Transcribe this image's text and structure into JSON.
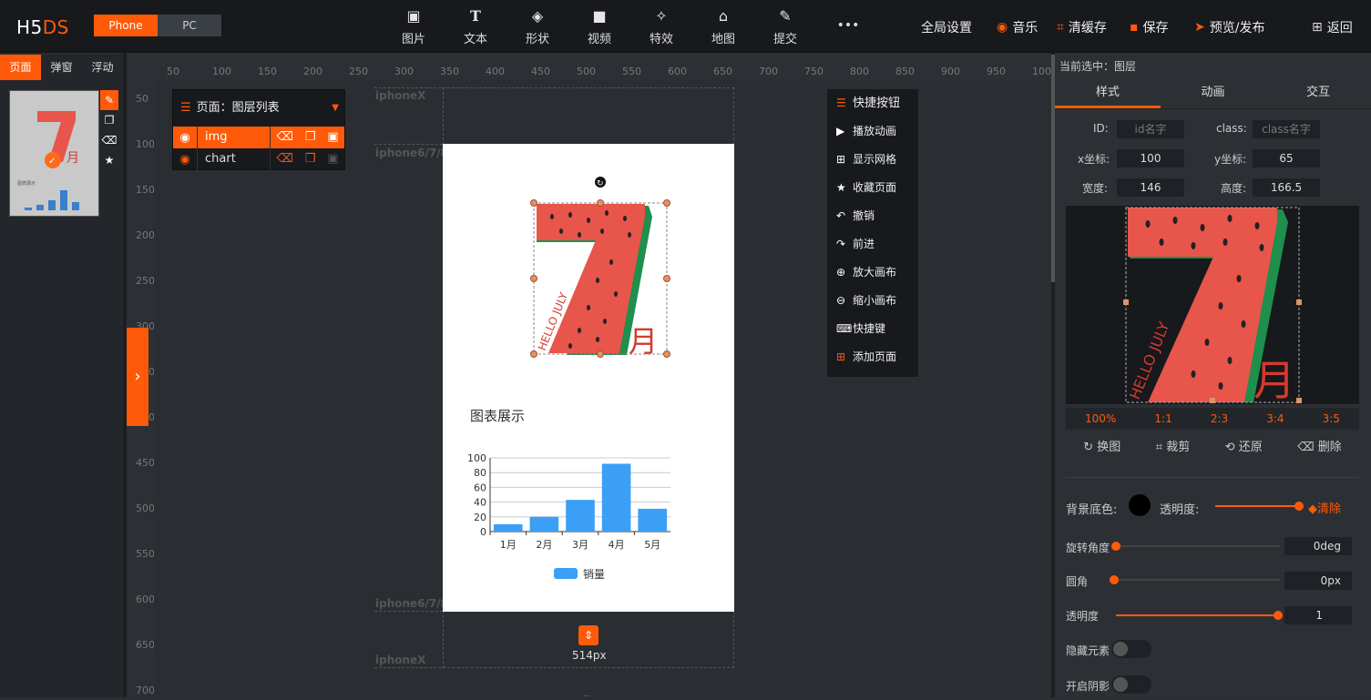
{
  "app": {
    "logo_a": "H5",
    "logo_b": "DS",
    "device_phone": "Phone",
    "device_pc": "PC"
  },
  "toolbar": [
    {
      "label": "图片",
      "icon": "image-icon"
    },
    {
      "label": "文本",
      "icon": "text-icon"
    },
    {
      "label": "形状",
      "icon": "shape-icon"
    },
    {
      "label": "视频",
      "icon": "video-icon"
    },
    {
      "label": "特效",
      "icon": "effect-icon"
    },
    {
      "label": "地图",
      "icon": "map-icon"
    },
    {
      "label": "提交",
      "icon": "submit-icon"
    },
    {
      "label": "•••",
      "icon": "more-icon"
    }
  ],
  "topright": {
    "global": "全局设置",
    "music": "音乐",
    "clear": "清缓存",
    "save": "保存",
    "publish": "预览/发布",
    "back": "返回"
  },
  "lefttabs": [
    "页面",
    "弹窗",
    "浮动"
  ],
  "thumb": {
    "chart_title": "图表展示"
  },
  "ruler_h": [
    "50",
    "100",
    "150",
    "200",
    "250",
    "300",
    "350",
    "400",
    "450",
    "500",
    "550",
    "600",
    "650",
    "700",
    "750",
    "800",
    "850",
    "900",
    "950",
    "100"
  ],
  "ruler_v": [
    "50",
    "100",
    "150",
    "200",
    "250",
    "300",
    "350",
    "400",
    "450",
    "500",
    "550",
    "600",
    "650",
    "700"
  ],
  "guides": {
    "iphonex_top": "iphoneX",
    "iphone678_top": "iphone6/7/8",
    "iphone678_bot": "iphone6/7/8",
    "iphonex_bot": "iphoneX"
  },
  "layerpanel": {
    "title": "页面：图层列表",
    "layers": [
      "img",
      "chart"
    ]
  },
  "quick": [
    "快捷按钮",
    "播放动画",
    "显示网格",
    "收藏页面",
    "撤销",
    "前进",
    "放大画布",
    "缩小画布",
    "快捷键",
    "添加页面"
  ],
  "phone": {
    "hello": "HELLO JULY",
    "month": "月",
    "height_label": "514px"
  },
  "chart_data": {
    "type": "bar",
    "title": "图表展示",
    "categories": [
      "1月",
      "2月",
      "3月",
      "4月",
      "5月"
    ],
    "series": [
      {
        "name": "销量",
        "values": [
          10,
          20,
          43,
          92,
          31
        ]
      }
    ],
    "ylim": [
      0,
      100
    ],
    "yticks": [
      0,
      20,
      40,
      60,
      80,
      100
    ],
    "color": "#3a9ff5",
    "grid": true,
    "legend": "bottom"
  },
  "right": {
    "current": "当前选中：图层",
    "tabs": [
      "样式",
      "动画",
      "交互"
    ],
    "id_label": "ID:",
    "id_ph": "id名字",
    "class_label": "class:",
    "class_ph": "class名字",
    "x_label": "x坐标:",
    "x_val": "100",
    "y_label": "y坐标:",
    "y_val": "65",
    "w_label": "宽度:",
    "w_val": "146",
    "h_label": "高度:",
    "h_val": "166.5",
    "ratios": [
      "100%",
      "1:1",
      "2:3",
      "3:4",
      "3:5"
    ],
    "imgops": [
      "换图",
      "裁剪",
      "还原",
      "删除"
    ],
    "bg_label": "背景底色:",
    "opacity_label": "透明度:",
    "clear": "清除",
    "rotate_label": "旋转角度",
    "rotate_val": "0deg",
    "radius_label": "圆角",
    "radius_val": "0px",
    "alpha_label": "透明度",
    "alpha_val": "1",
    "hide_label": "隐藏元素",
    "shadow_label": "开启阴影"
  },
  "colors": {
    "accent": "#ff5a0a",
    "chart_blue": "#3a9ff5"
  }
}
